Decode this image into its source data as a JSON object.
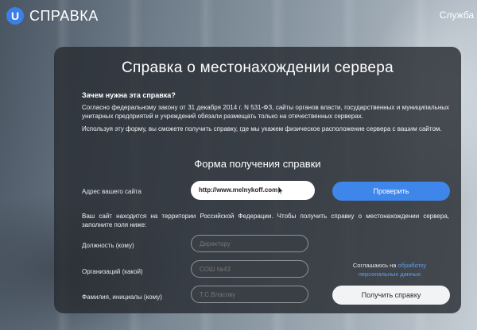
{
  "header": {
    "logo_letter": "U",
    "logo_text": "СПРАВКА",
    "service_link": "Служба"
  },
  "card": {
    "title": "Справка о местонахождении сервера",
    "why_heading": "Зачем нужна эта справка?",
    "paragraph_law": "Согласно федеральному закону от 31 декабря 2014 г. N 531-ФЗ, сайты органов власти, государственных и муниципальных унитарных предприятий и учреждений обязали размещать только на отечественных серверах.",
    "paragraph_form": "Используя эту форму, вы сможете получить справку, где мы укажем физическое расположение сервера с вашим сайтом.",
    "form_heading": "Форма получения справки",
    "site_label": "Адрес вашего сайта",
    "site_value": "http://www.melnykoff.com",
    "check_button": "Проверить",
    "result_text": "Ваш сайт находится на территории Российской Федерации. Чтобы получить справку о местонахождении сервера, заполните поля ниже:",
    "fields": {
      "position_label": "Должность (кому)",
      "position_placeholder": "Директору",
      "org_label": "Организаций (какой)",
      "org_placeholder": "СОШ №43",
      "name_label": "Фамилия, инициалы (кому)",
      "name_placeholder": "Т.С.Власову"
    },
    "consent_text": "Соглашаюсь на",
    "consent_link": "обработку персональных данных",
    "submit_button": "Получить справку"
  },
  "colors": {
    "accent": "#3f86ea",
    "card_bg": "#282c32"
  }
}
